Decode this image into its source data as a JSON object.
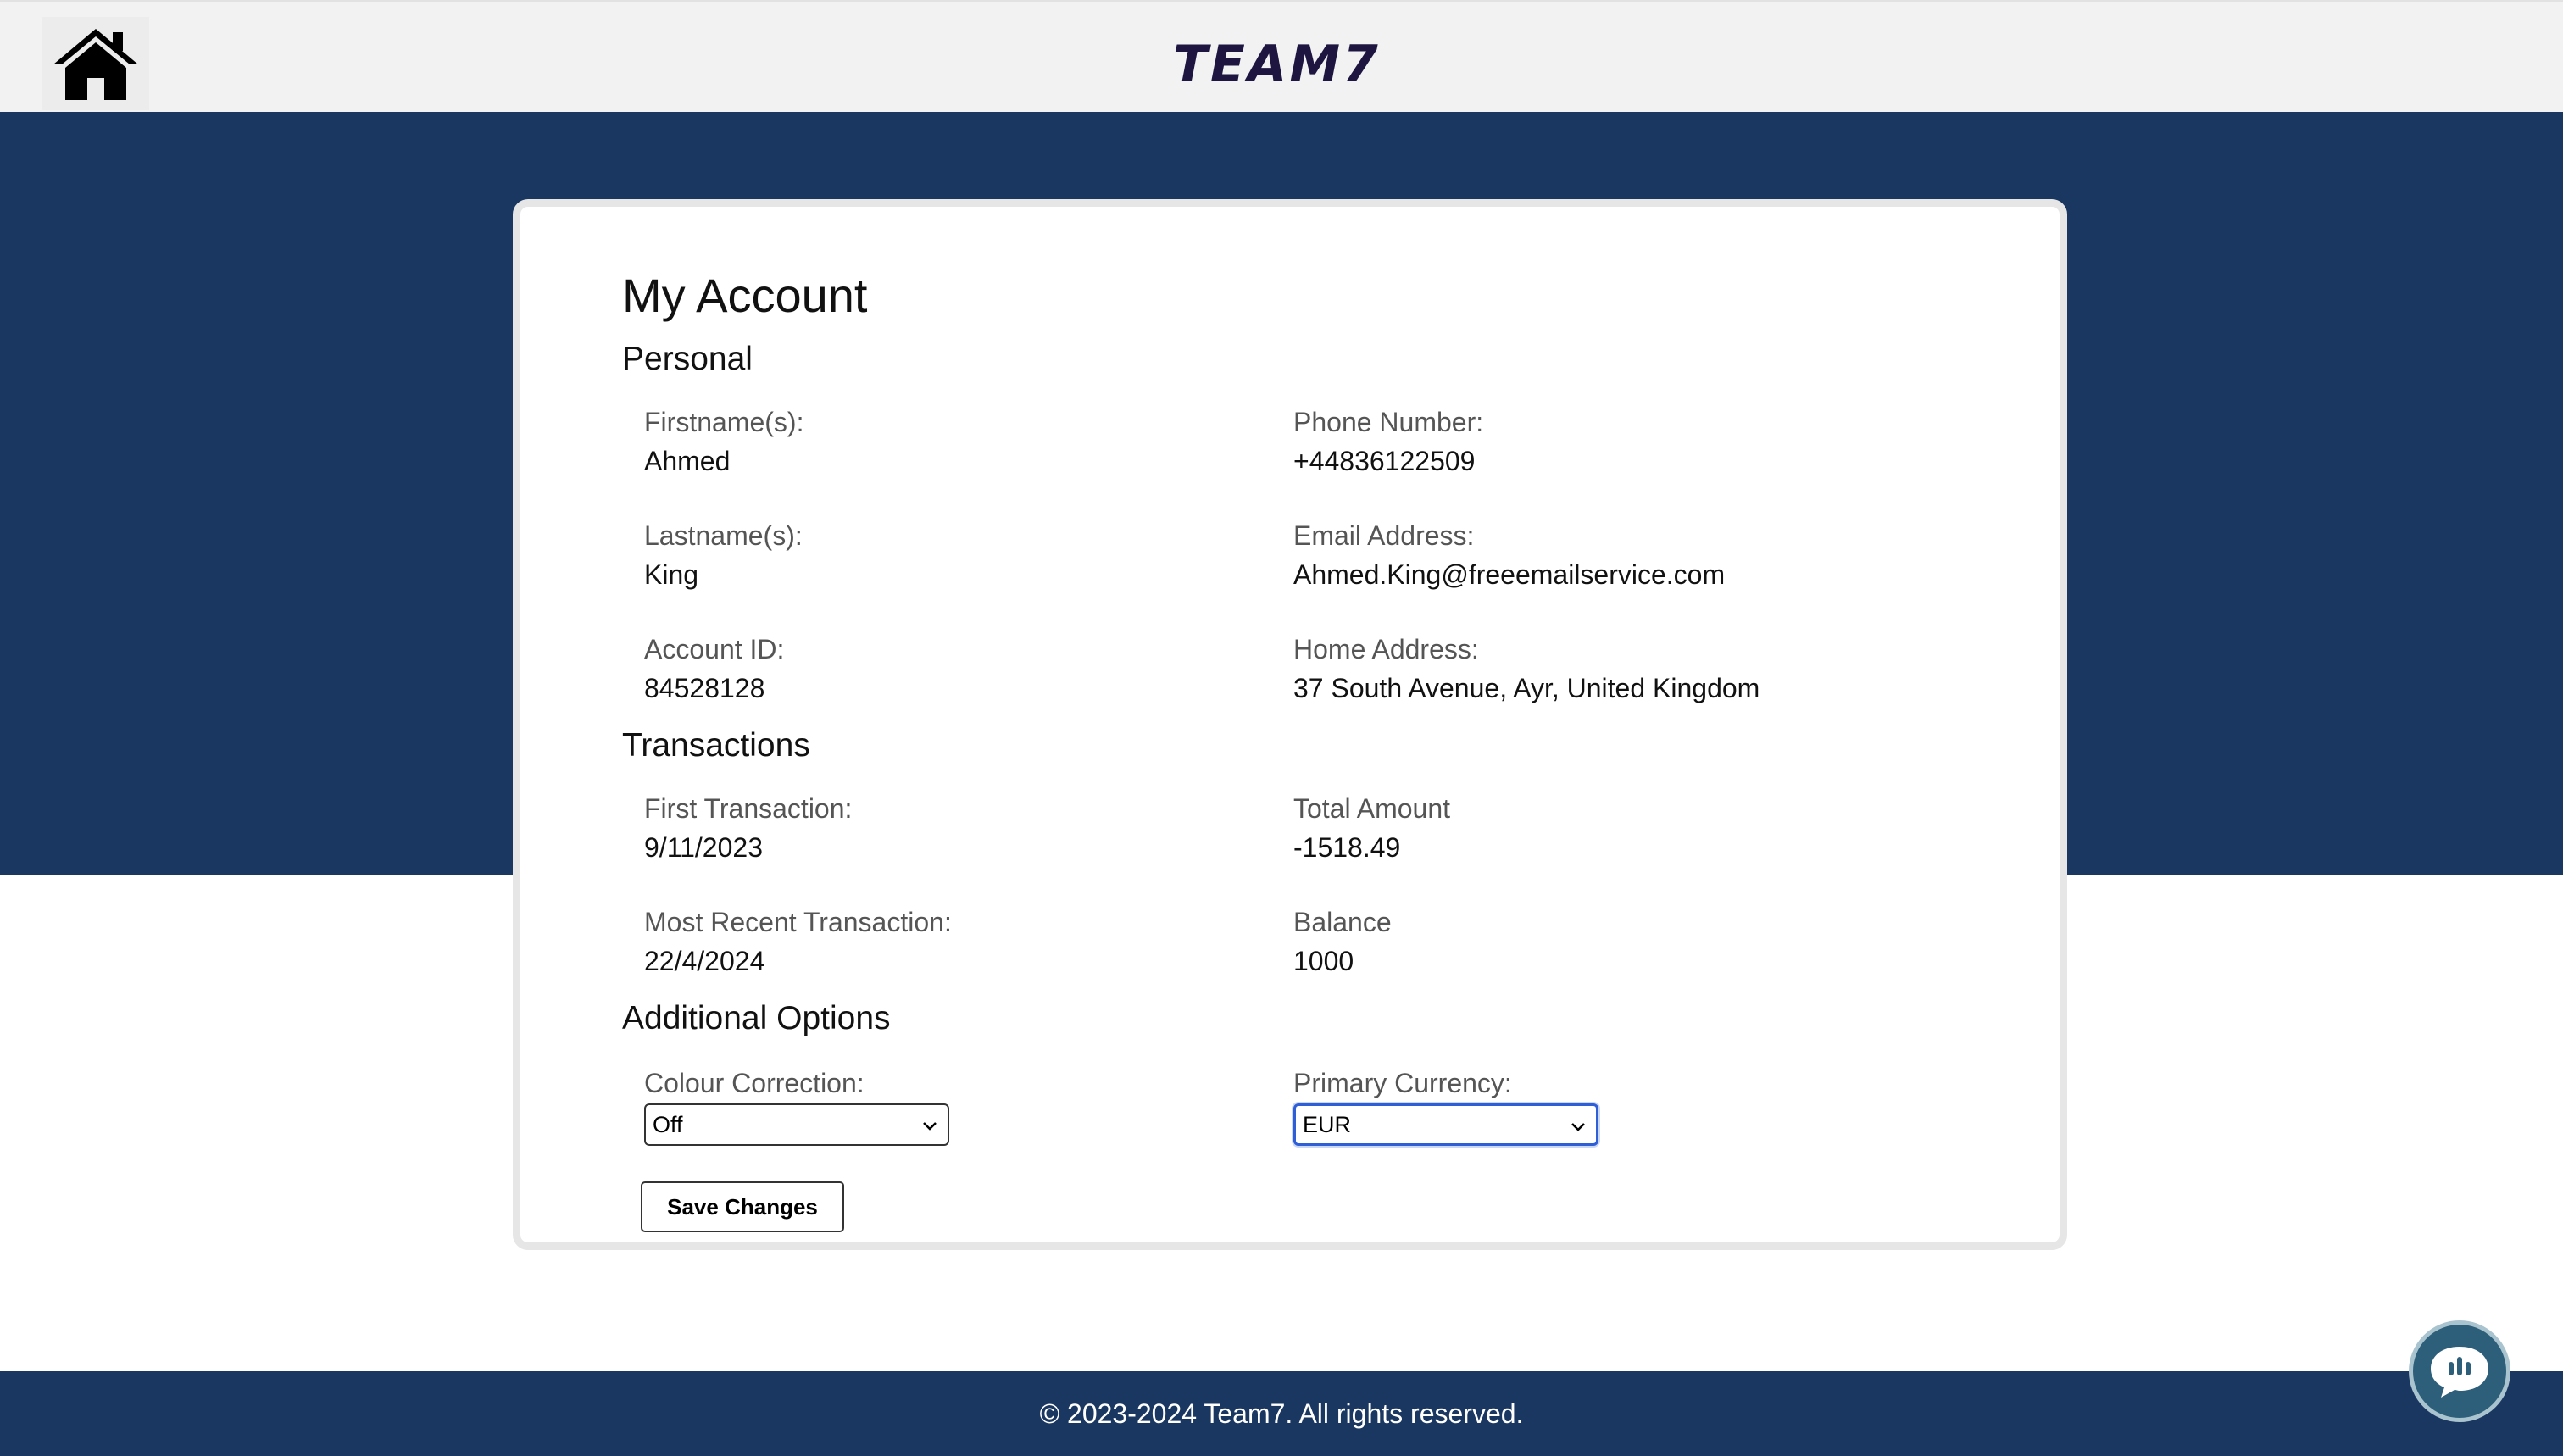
{
  "header": {
    "home_icon": "home-icon",
    "logo_text": "TEAM7"
  },
  "account": {
    "title": "My Account",
    "personal": {
      "heading": "Personal",
      "firstname_label": "Firstname(s):",
      "firstname": "Ahmed",
      "lastname_label": "Lastname(s):",
      "lastname": "King",
      "account_id_label": "Account ID:",
      "account_id": "84528128",
      "phone_label": "Phone Number:",
      "phone": "+44836122509",
      "email_label": "Email Address:",
      "email": "Ahmed.King@freeemailservice.com",
      "address_label": "Home Address:",
      "address": "37 South Avenue, Ayr, United Kingdom"
    },
    "transactions": {
      "heading": "Transactions",
      "first_label": "First Transaction:",
      "first": "9/11/2023",
      "recent_label": "Most Recent Transaction:",
      "recent": "22/4/2024",
      "total_label": "Total Amount",
      "total": "-1518.49",
      "balance_label": "Balance",
      "balance": "1000"
    },
    "options": {
      "heading": "Additional Options",
      "colour_label": "Colour Correction:",
      "colour_value": "Off",
      "currency_label": "Primary Currency:",
      "currency_value": "EUR",
      "save_label": "Save Changes"
    }
  },
  "footer": {
    "copyright": "© 2023-2024 Team7. All rights reserved."
  },
  "colors": {
    "band": "#1a3761",
    "header_bg": "#f2f2f2",
    "chat_button": "#2d5f7a",
    "focus_ring": "#2e5fd6"
  }
}
